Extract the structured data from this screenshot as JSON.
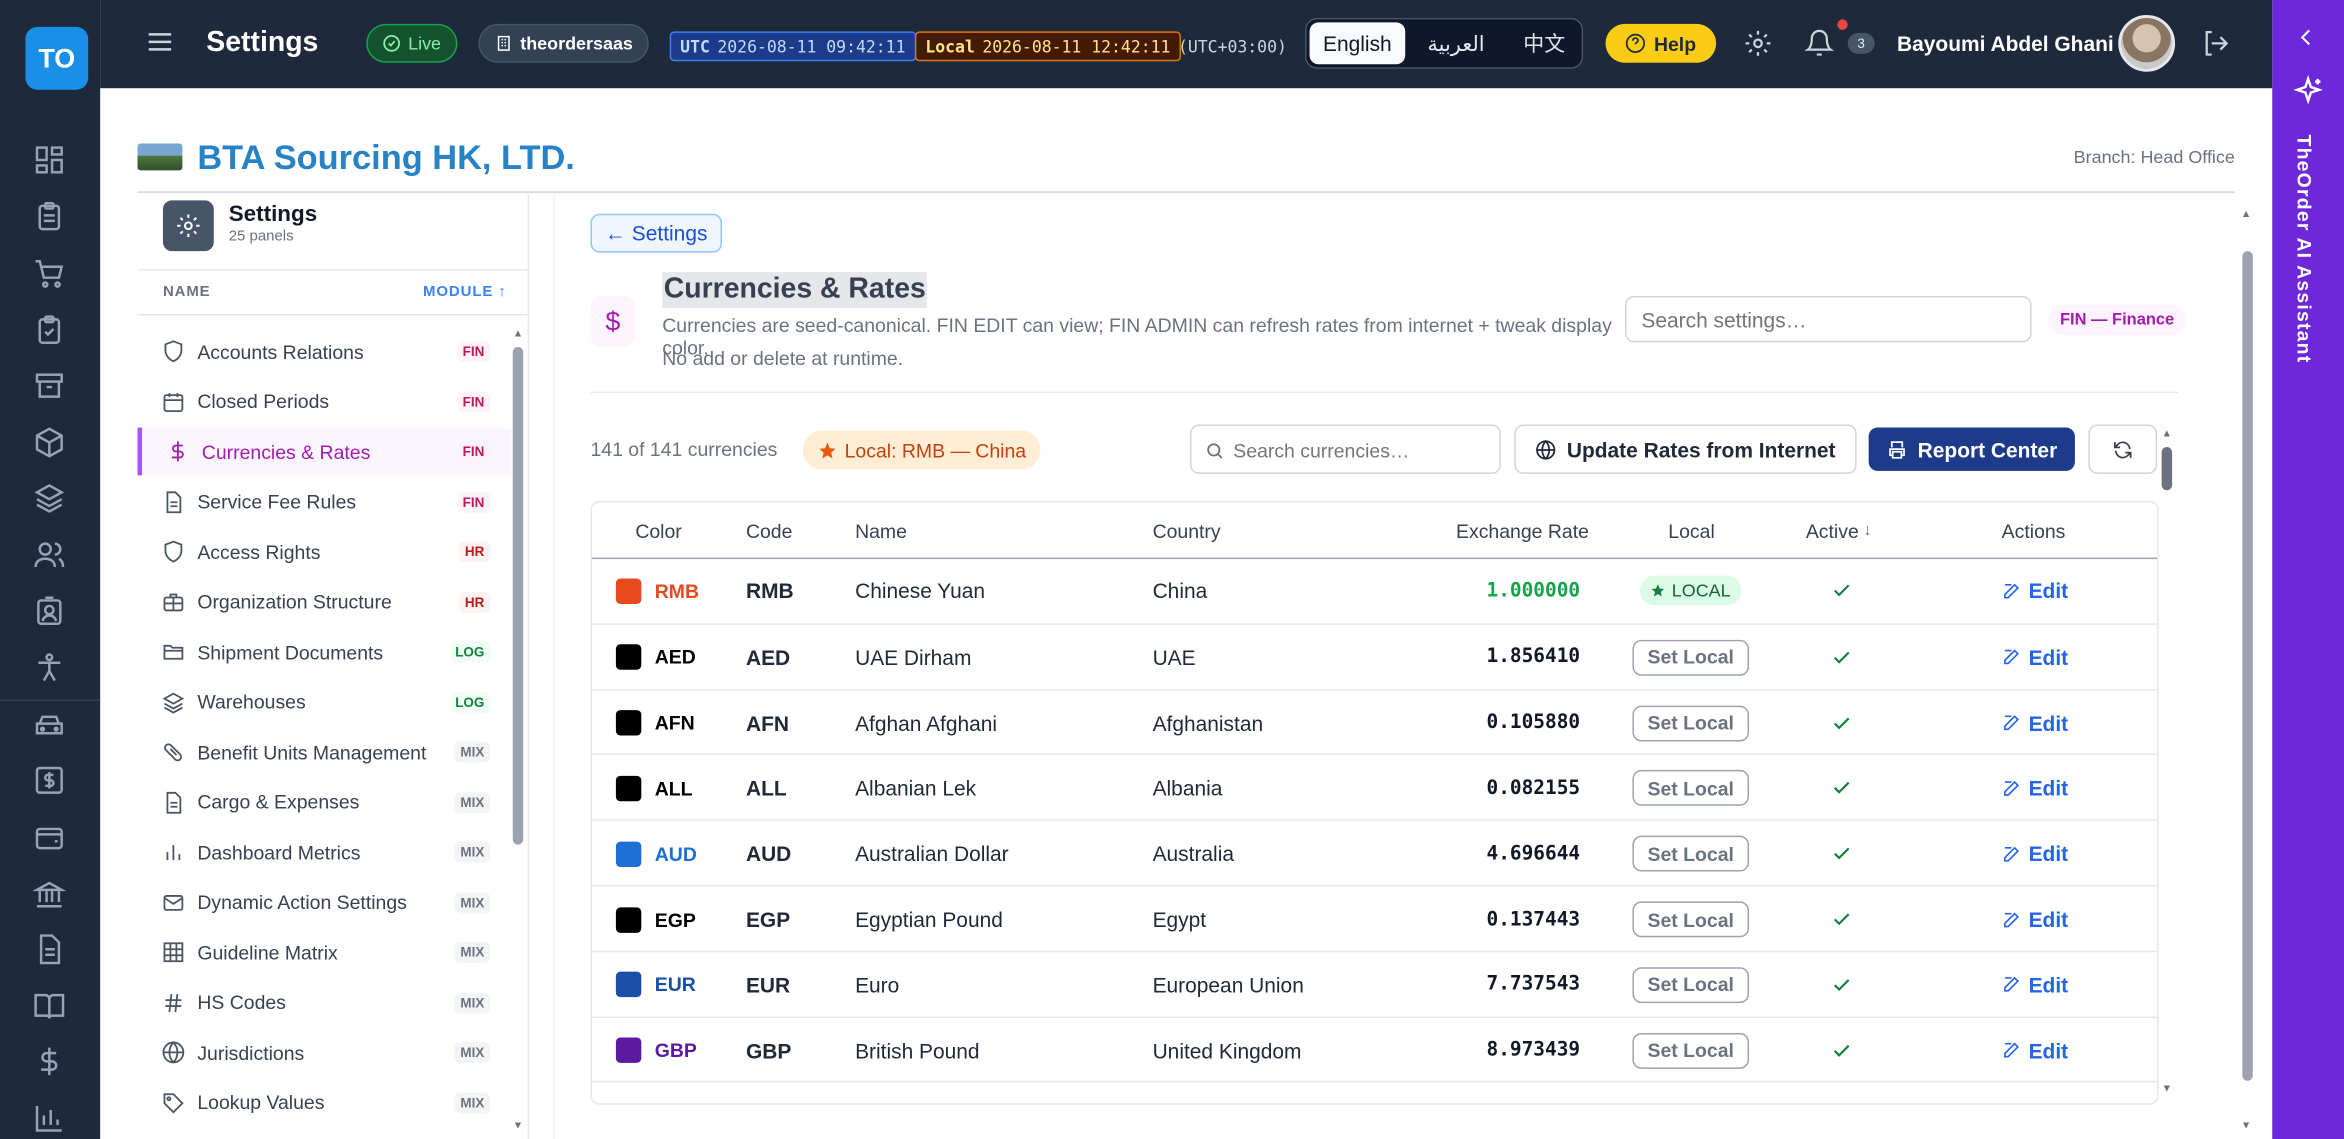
{
  "app": {
    "logo": "TO",
    "title": "Settings",
    "live": "Live",
    "tenant": "theordersaas",
    "utc_label": "UTC",
    "utc_time": "2026-08-11 09:42:11",
    "local_label": "Local",
    "local_time": "2026-08-11 12:42:11",
    "tz": "(UTC+03:00)",
    "languages": [
      "English",
      "العربية",
      "中文"
    ],
    "help": "Help",
    "notif_count": "3",
    "user": "Bayoumi Abdel Ghani"
  },
  "assistant": {
    "label": "TheOrder AI Assistant"
  },
  "company": {
    "name": "BTA Sourcing HK, LTD.",
    "branch": "Branch: Head Office"
  },
  "sidebar": {
    "title": "Settings",
    "subtitle": "25 panels",
    "col_name": "NAME",
    "col_module": "MODULE ↑",
    "items": [
      {
        "label": "Accounts Relations",
        "badge": "FIN",
        "icon": "shield-icon"
      },
      {
        "label": "Closed Periods",
        "badge": "FIN",
        "icon": "calendar-icon"
      },
      {
        "label": "Currencies & Rates",
        "badge": "FIN",
        "icon": "dollar-icon"
      },
      {
        "label": "Service Fee Rules",
        "badge": "FIN",
        "icon": "document-icon"
      },
      {
        "label": "Access Rights",
        "badge": "HR",
        "icon": "shield-icon"
      },
      {
        "label": "Organization Structure",
        "badge": "HR",
        "icon": "briefcase-icon"
      },
      {
        "label": "Shipment Documents",
        "badge": "LOG",
        "icon": "folder-icon"
      },
      {
        "label": "Warehouses",
        "badge": "LOG",
        "icon": "layers-icon"
      },
      {
        "label": "Benefit Units Management",
        "badge": "MIX",
        "icon": "pill-icon"
      },
      {
        "label": "Cargo & Expenses",
        "badge": "MIX",
        "icon": "document-icon"
      },
      {
        "label": "Dashboard Metrics",
        "badge": "MIX",
        "icon": "bar-chart-icon"
      },
      {
        "label": "Dynamic Action Settings",
        "badge": "MIX",
        "icon": "mail-icon"
      },
      {
        "label": "Guideline Matrix",
        "badge": "MIX",
        "icon": "grid-icon"
      },
      {
        "label": "HS Codes",
        "badge": "MIX",
        "icon": "hash-icon"
      },
      {
        "label": "Jurisdictions",
        "badge": "MIX",
        "icon": "globe-icon"
      },
      {
        "label": "Lookup Values",
        "badge": "MIX",
        "icon": "tag-icon"
      }
    ]
  },
  "main": {
    "back": "← Settings",
    "title": "Currencies & Rates",
    "desc1": "Currencies are seed-canonical. FIN EDIT can view; FIN ADMIN can refresh rates from internet + tweak display color.",
    "desc2": "No add or delete at runtime.",
    "search_settings": "Search settings…",
    "module_badge": "FIN — Finance",
    "count": "141 of 141 currencies",
    "local_chip": "Local: RMB — China",
    "search_currencies": "Search currencies…",
    "update_btn": "Update Rates from Internet",
    "report_btn": "Report Center"
  },
  "table": {
    "headers": [
      "Color",
      "Code",
      "Name",
      "Country",
      "Exchange Rate",
      "Local",
      "Active",
      "Actions"
    ],
    "active_sort": "↓",
    "local_label": "LOCAL",
    "set_local": "Set Local",
    "edit": "Edit",
    "rows": [
      {
        "color": "#e84a1e",
        "code": "RMB",
        "name": "Chinese Yuan",
        "country": "China",
        "rate": "1.000000",
        "local": true
      },
      {
        "color": "#000000",
        "code": "AED",
        "name": "UAE Dirham",
        "country": "UAE",
        "rate": "1.856410",
        "local": false
      },
      {
        "color": "#000000",
        "code": "AFN",
        "name": "Afghan Afghani",
        "country": "Afghanistan",
        "rate": "0.105880",
        "local": false
      },
      {
        "color": "#000000",
        "code": "ALL",
        "name": "Albanian Lek",
        "country": "Albania",
        "rate": "0.082155",
        "local": false
      },
      {
        "color": "#1d6fd4",
        "code": "AUD",
        "name": "Australian Dollar",
        "country": "Australia",
        "rate": "4.696644",
        "local": false
      },
      {
        "color": "#000000",
        "code": "EGP",
        "name": "Egyptian Pound",
        "country": "Egypt",
        "rate": "0.137443",
        "local": false
      },
      {
        "color": "#1a4fa8",
        "code": "EUR",
        "name": "Euro",
        "country": "European Union",
        "rate": "7.737543",
        "local": false
      },
      {
        "color": "#5b1aa0",
        "code": "GBP",
        "name": "British Pound",
        "country": "United Kingdom",
        "rate": "8.973439",
        "local": false
      }
    ]
  }
}
